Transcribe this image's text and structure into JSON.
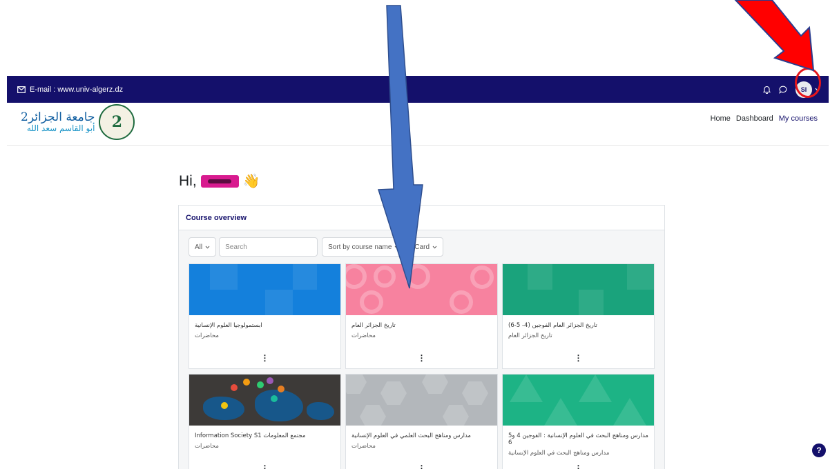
{
  "topbar": {
    "email_text": "E-mail : www.univ-algerz.dz",
    "avatar_initials": "SI"
  },
  "logo": {
    "line1": "جامعة الجزائر2",
    "line2": "أبو القاسم سعد الله",
    "seal_text": "2"
  },
  "nav": {
    "items": [
      "Home",
      "Dashboard",
      "My courses"
    ]
  },
  "greeting": {
    "prefix": "Hi,",
    "wave": "👋"
  },
  "overview": {
    "title": "Course overview",
    "filter_all": "All",
    "search_placeholder": "Search",
    "sort_label": "Sort by course name",
    "view_label": "Card"
  },
  "courses": [
    {
      "name": "ابستمولوجيا العلوم الإنسانية",
      "category": "محاضرات",
      "tile": "blue"
    },
    {
      "name": "تاريخ الجزائر العام",
      "category": "محاضرات",
      "tile": "pink"
    },
    {
      "name": "تاريخ الجزائر العام الفوجين (4- 5-6)",
      "category": "تاريخ الجزائر العام",
      "tile": "green"
    },
    {
      "name": "Information Society S1 مجتمع المعلومات",
      "category": "محاضرات",
      "tile": "world"
    },
    {
      "name": "مدارس ومناهج البحث العلمي في العلوم الإنسانية",
      "category": "محاضرات",
      "tile": "grey"
    },
    {
      "name": "مدارس ومناهج البحث في العلوم الإنسانية : الفوجين 4 و5 6",
      "category": "مدارس ومناهج البحث في العلوم الإنسانية",
      "tile": "green2"
    }
  ],
  "help": {
    "label": "?"
  },
  "colors": {
    "topbar": "#14106b",
    "annotation_arrow_blue": "#4472c4",
    "annotation_arrow_red": "#e5151b"
  }
}
